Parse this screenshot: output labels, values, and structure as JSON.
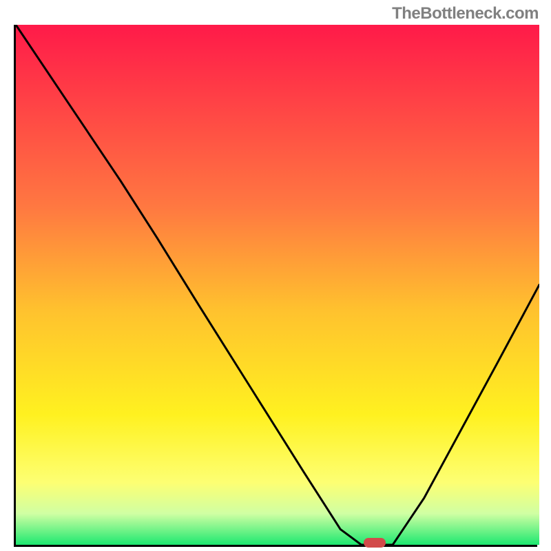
{
  "watermark": "TheBottleneck.com",
  "chart_data": {
    "type": "line",
    "title": "",
    "xlabel": "",
    "ylabel": "",
    "xlim": [
      0,
      100
    ],
    "ylim": [
      0,
      100
    ],
    "grid": false,
    "legend": false,
    "background_gradient": {
      "stops": [
        {
          "pos": 0,
          "color": "#ff1a49"
        },
        {
          "pos": 35,
          "color": "#ff7841"
        },
        {
          "pos": 55,
          "color": "#ffc22e"
        },
        {
          "pos": 75,
          "color": "#fff120"
        },
        {
          "pos": 88,
          "color": "#fdff73"
        },
        {
          "pos": 94,
          "color": "#d0ffa3"
        },
        {
          "pos": 100,
          "color": "#1de870"
        }
      ]
    },
    "series": [
      {
        "name": "bottleneck-curve",
        "x": [
          0,
          10,
          20,
          27,
          35,
          45,
          55,
          62,
          66,
          69,
          72,
          78,
          85,
          92,
          100
        ],
        "y": [
          100,
          85,
          70,
          59,
          46,
          30,
          14,
          3,
          0,
          0,
          0,
          9,
          22,
          35,
          50
        ]
      }
    ],
    "marker": {
      "name": "target-marker",
      "x": 68.5,
      "y": 0,
      "color": "#d24a4a"
    }
  }
}
